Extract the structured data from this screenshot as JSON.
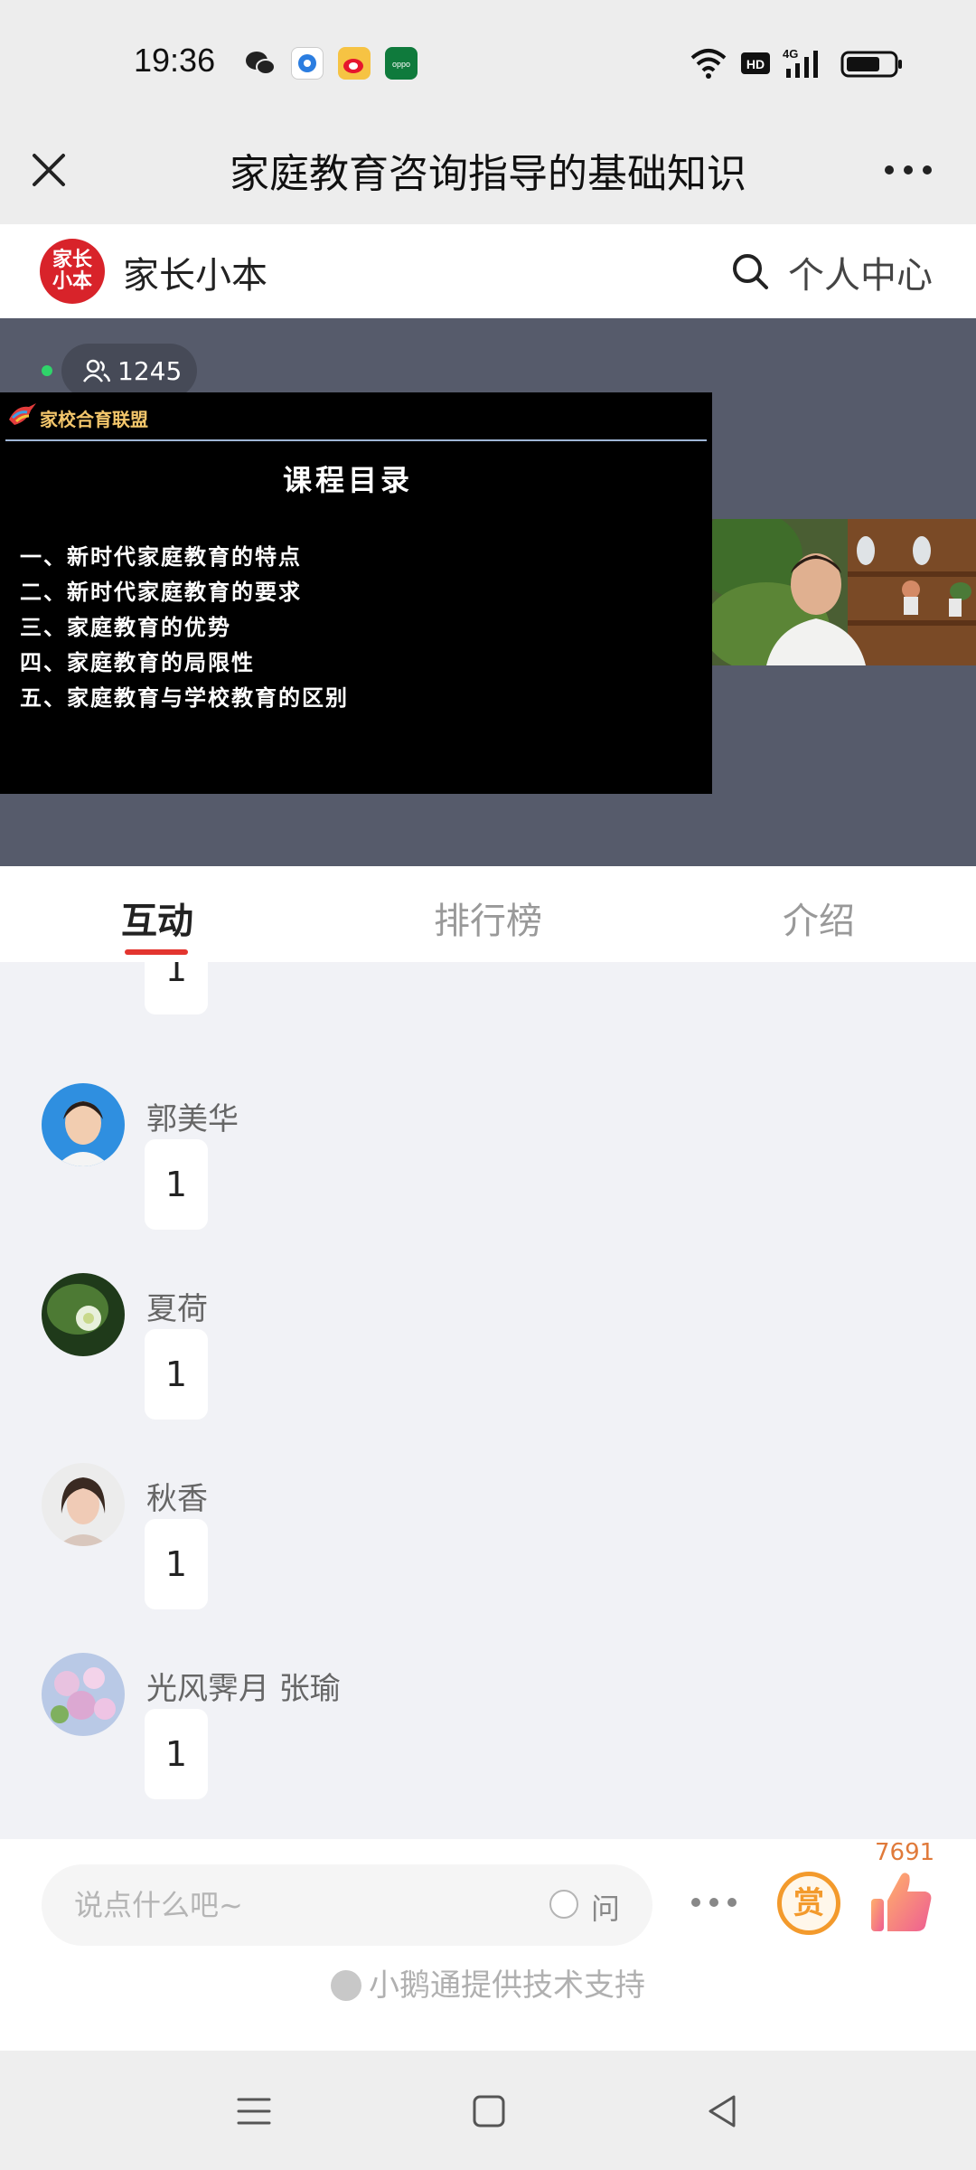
{
  "status_bar": {
    "time": "19:36",
    "apps": [
      "wechat-icon",
      "browser-icon",
      "weibo-icon",
      "oppo-icon"
    ],
    "network": "4G",
    "hd_label": "HD"
  },
  "title_bar": {
    "title": "家庭教育咨询指导的基础知识"
  },
  "brand": {
    "logo_text_1": "家长",
    "logo_text_2": "小本",
    "name": "家长小本",
    "profile_link": "个人中心"
  },
  "video": {
    "viewer_count": "1245",
    "slide": {
      "brand": "家校合育联盟",
      "title": "课程目录",
      "items": [
        "一、新时代家庭教育的特点",
        "二、新时代家庭教育的要求",
        "三、家庭教育的优势",
        "四、家庭教育的局限性",
        "五、家庭教育与学校教育的区别"
      ]
    }
  },
  "tabs": [
    {
      "label": "互动",
      "active": true
    },
    {
      "label": "排行榜",
      "active": false
    },
    {
      "label": "介绍",
      "active": false
    }
  ],
  "messages": [
    {
      "name": "",
      "text": "1"
    },
    {
      "name": "郭美华",
      "text": "1"
    },
    {
      "name": "夏荷",
      "text": "1"
    },
    {
      "name": "秋香",
      "text": "1"
    },
    {
      "name": "光风霁月 张瑜",
      "text": "1"
    }
  ],
  "input_bar": {
    "placeholder": "说点什么吧~",
    "ask_label": "问",
    "reward_label": "赏",
    "like_count": "7691",
    "support_text": "小鹅通提供技术支持"
  },
  "colors": {
    "accent_red": "#e3352f",
    "reward_orange": "#f39a2c",
    "like_pink": "#f06a8e"
  }
}
